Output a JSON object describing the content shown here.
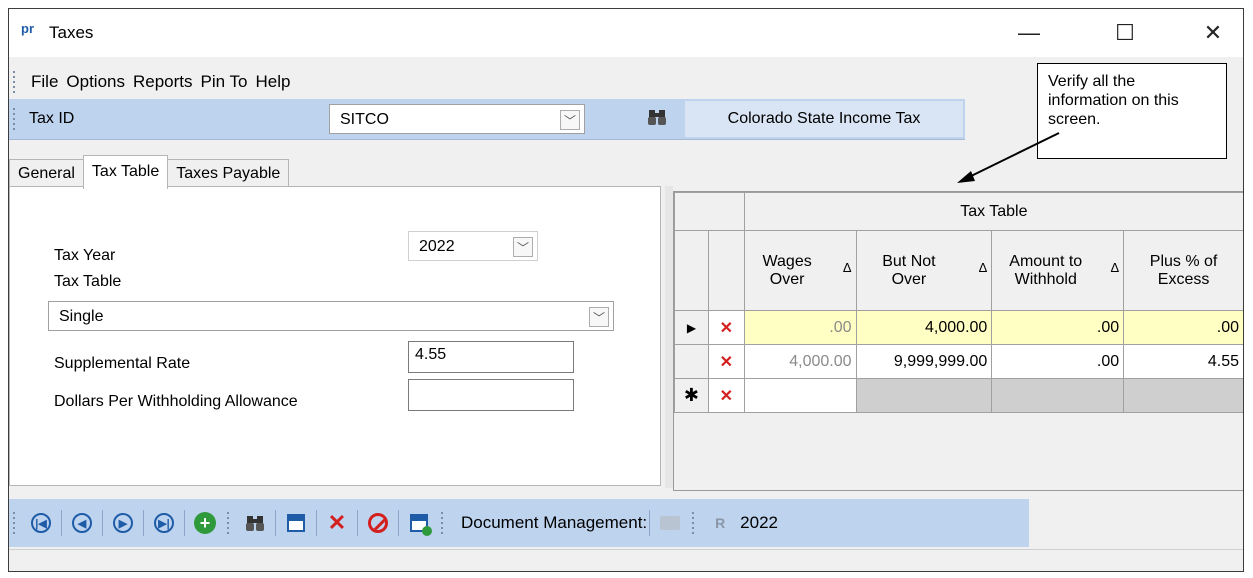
{
  "window": {
    "app_icon": "pr",
    "title": "Taxes",
    "minimize": "—",
    "maximize": "☐",
    "close": "✕"
  },
  "menu": [
    "File",
    "Options",
    "Reports",
    "Pin To",
    "Help"
  ],
  "taxbar": {
    "label": "Tax ID",
    "tax_id": "SITCO",
    "tax_name": "Colorado State Income Tax"
  },
  "tabs": [
    "General",
    "Tax Table",
    "Taxes Payable"
  ],
  "form": {
    "tax_year_label": "Tax Year",
    "tax_year": "2022",
    "tax_table_label": "Tax Table",
    "tax_table": "Single",
    "supp_rate_label": "Supplemental Rate",
    "supp_rate": "4.55",
    "dollars_label": "Dollars Per Withholding Allowance",
    "dollars": ""
  },
  "grid": {
    "title": "Tax Table",
    "sort_glyph": "Δ",
    "columns": [
      "Wages Over",
      "But Not Over",
      "Amount to Withhold",
      "Plus % of Excess"
    ],
    "rows": [
      {
        "wages_over": ".00",
        "but_not_over": "4,000.00",
        "amount": ".00",
        "plus_pct": ".00"
      },
      {
        "wages_over": "4,000.00",
        "but_not_over": "9,999,999.00",
        "amount": ".00",
        "plus_pct": "4.55"
      }
    ],
    "new_row_marker": "✱",
    "current_row_marker": "▶"
  },
  "callout": "Verify all the information on this screen.",
  "bottombar": {
    "doc_mgmt": "Document Management:",
    "year": "2022"
  },
  "icons": [
    "first-record-icon",
    "previous-record-icon",
    "next-record-icon",
    "last-record-icon",
    "add-icon",
    "find-icon",
    "save-icon",
    "delete-icon",
    "cancel-icon",
    "save-new-icon",
    "folder-icon",
    "report-icon"
  ],
  "colors": {
    "toolbar": "#bed3ee",
    "accent": "#1f5ca8",
    "edit_row": "#ffffc4",
    "delete": "#d41f1f"
  }
}
